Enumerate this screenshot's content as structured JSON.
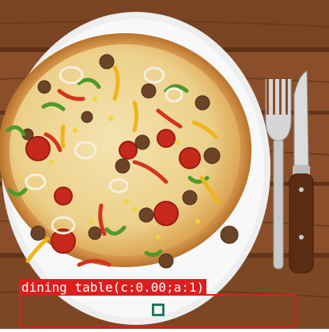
{
  "detection": {
    "label": "dining table(c:0.00;a:1)",
    "box_color": "#dc1e1e",
    "marker_color": "#1f7a5c"
  },
  "scene": {
    "subject": "pizza",
    "objects": [
      "pizza",
      "plate",
      "fork",
      "knife",
      "wooden table"
    ]
  }
}
